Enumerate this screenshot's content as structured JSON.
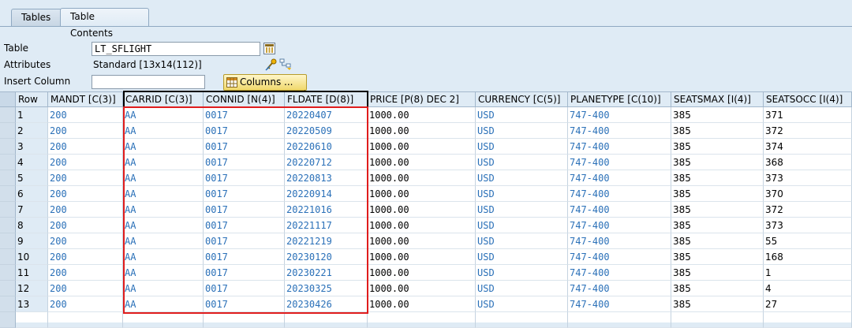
{
  "tabs": [
    {
      "label": "Tables"
    },
    {
      "label": "Table Contents"
    }
  ],
  "form": {
    "table_label": "Table",
    "table_value": "LT_SFLIGHT",
    "attributes_label": "Attributes",
    "attributes_value": "Standard [13x14(112)]",
    "insert_column_label": "Insert Column",
    "insert_column_value": "",
    "columns_button": "Columns ..."
  },
  "grid": {
    "columns": [
      "Row",
      "MANDT [C(3)]",
      "CARRID [C(3)]",
      "CONNID [N(4)]",
      "FLDATE [D(8)]",
      "PRICE [P(8) DEC 2]",
      "CURRENCY [C(5)]",
      "PLANETYPE [C(10)]",
      "SEATSMAX [I(4)]",
      "SEATSOCC [I(4)]"
    ],
    "rows": [
      [
        "1",
        "200",
        "AA",
        "0017",
        "20220407",
        "1000.00",
        "USD",
        "747-400",
        "385",
        "371"
      ],
      [
        "2",
        "200",
        "AA",
        "0017",
        "20220509",
        "1000.00",
        "USD",
        "747-400",
        "385",
        "372"
      ],
      [
        "3",
        "200",
        "AA",
        "0017",
        "20220610",
        "1000.00",
        "USD",
        "747-400",
        "385",
        "374"
      ],
      [
        "4",
        "200",
        "AA",
        "0017",
        "20220712",
        "1000.00",
        "USD",
        "747-400",
        "385",
        "368"
      ],
      [
        "5",
        "200",
        "AA",
        "0017",
        "20220813",
        "1000.00",
        "USD",
        "747-400",
        "385",
        "373"
      ],
      [
        "6",
        "200",
        "AA",
        "0017",
        "20220914",
        "1000.00",
        "USD",
        "747-400",
        "385",
        "370"
      ],
      [
        "7",
        "200",
        "AA",
        "0017",
        "20221016",
        "1000.00",
        "USD",
        "747-400",
        "385",
        "372"
      ],
      [
        "8",
        "200",
        "AA",
        "0017",
        "20221117",
        "1000.00",
        "USD",
        "747-400",
        "385",
        "373"
      ],
      [
        "9",
        "200",
        "AA",
        "0017",
        "20221219",
        "1000.00",
        "USD",
        "747-400",
        "385",
        "55"
      ],
      [
        "10",
        "200",
        "AA",
        "0017",
        "20230120",
        "1000.00",
        "USD",
        "747-400",
        "385",
        "168"
      ],
      [
        "11",
        "200",
        "AA",
        "0017",
        "20230221",
        "1000.00",
        "USD",
        "747-400",
        "385",
        "1"
      ],
      [
        "12",
        "200",
        "AA",
        "0017",
        "20230325",
        "1000.00",
        "USD",
        "747-400",
        "385",
        "4"
      ],
      [
        "13",
        "200",
        "AA",
        "0017",
        "20230426",
        "1000.00",
        "USD",
        "747-400",
        "385",
        "27"
      ]
    ]
  },
  "colors": {
    "key_value_blue": "#2a70b8",
    "highlight_red": "#e01d1d",
    "background": "#dfebf5"
  }
}
